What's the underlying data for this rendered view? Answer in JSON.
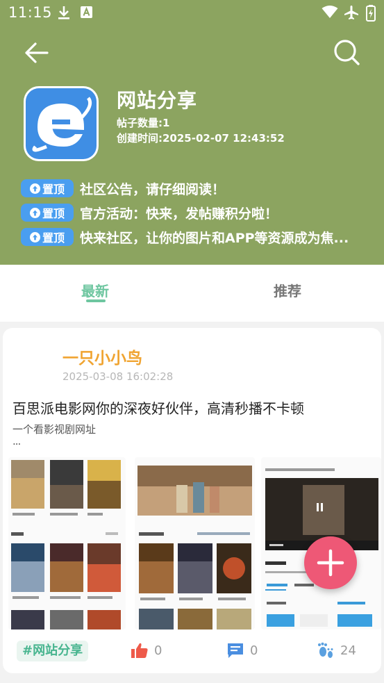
{
  "status_bar": {
    "time": "11:15"
  },
  "header": {
    "title": "网站分享",
    "post_count": "帖子数量:1",
    "created_at": "创建时间:2025-02-07 12:43:52",
    "pinned": [
      {
        "badge": "置顶",
        "text": "社区公告，请仔细阅读！"
      },
      {
        "badge": "置顶",
        "text": "官方活动：快来，发帖赚积分啦！"
      },
      {
        "badge": "置顶",
        "text": "快来社区，让你的图片和APP等资源成为焦..."
      }
    ]
  },
  "tabs": {
    "latest": "最新",
    "recommend": "推荐",
    "active": "latest"
  },
  "post": {
    "author": "一只小小鸟",
    "time": "2025-03-08 16:02:28",
    "title": "百思派电影网你的深夜好伙伴，高清秒播不卡顿",
    "subtitle": "一个看影视剧网址",
    "more": "...",
    "tag": "#网站分享",
    "likes": "0",
    "comments": "0",
    "visits": "24"
  },
  "colors": {
    "header_bg": "#8ca460",
    "accent_green": "#6ec6a0",
    "author_orange": "#f0a431",
    "pin_blue": "#4a9ef0",
    "fab_pink": "#ee5876"
  }
}
